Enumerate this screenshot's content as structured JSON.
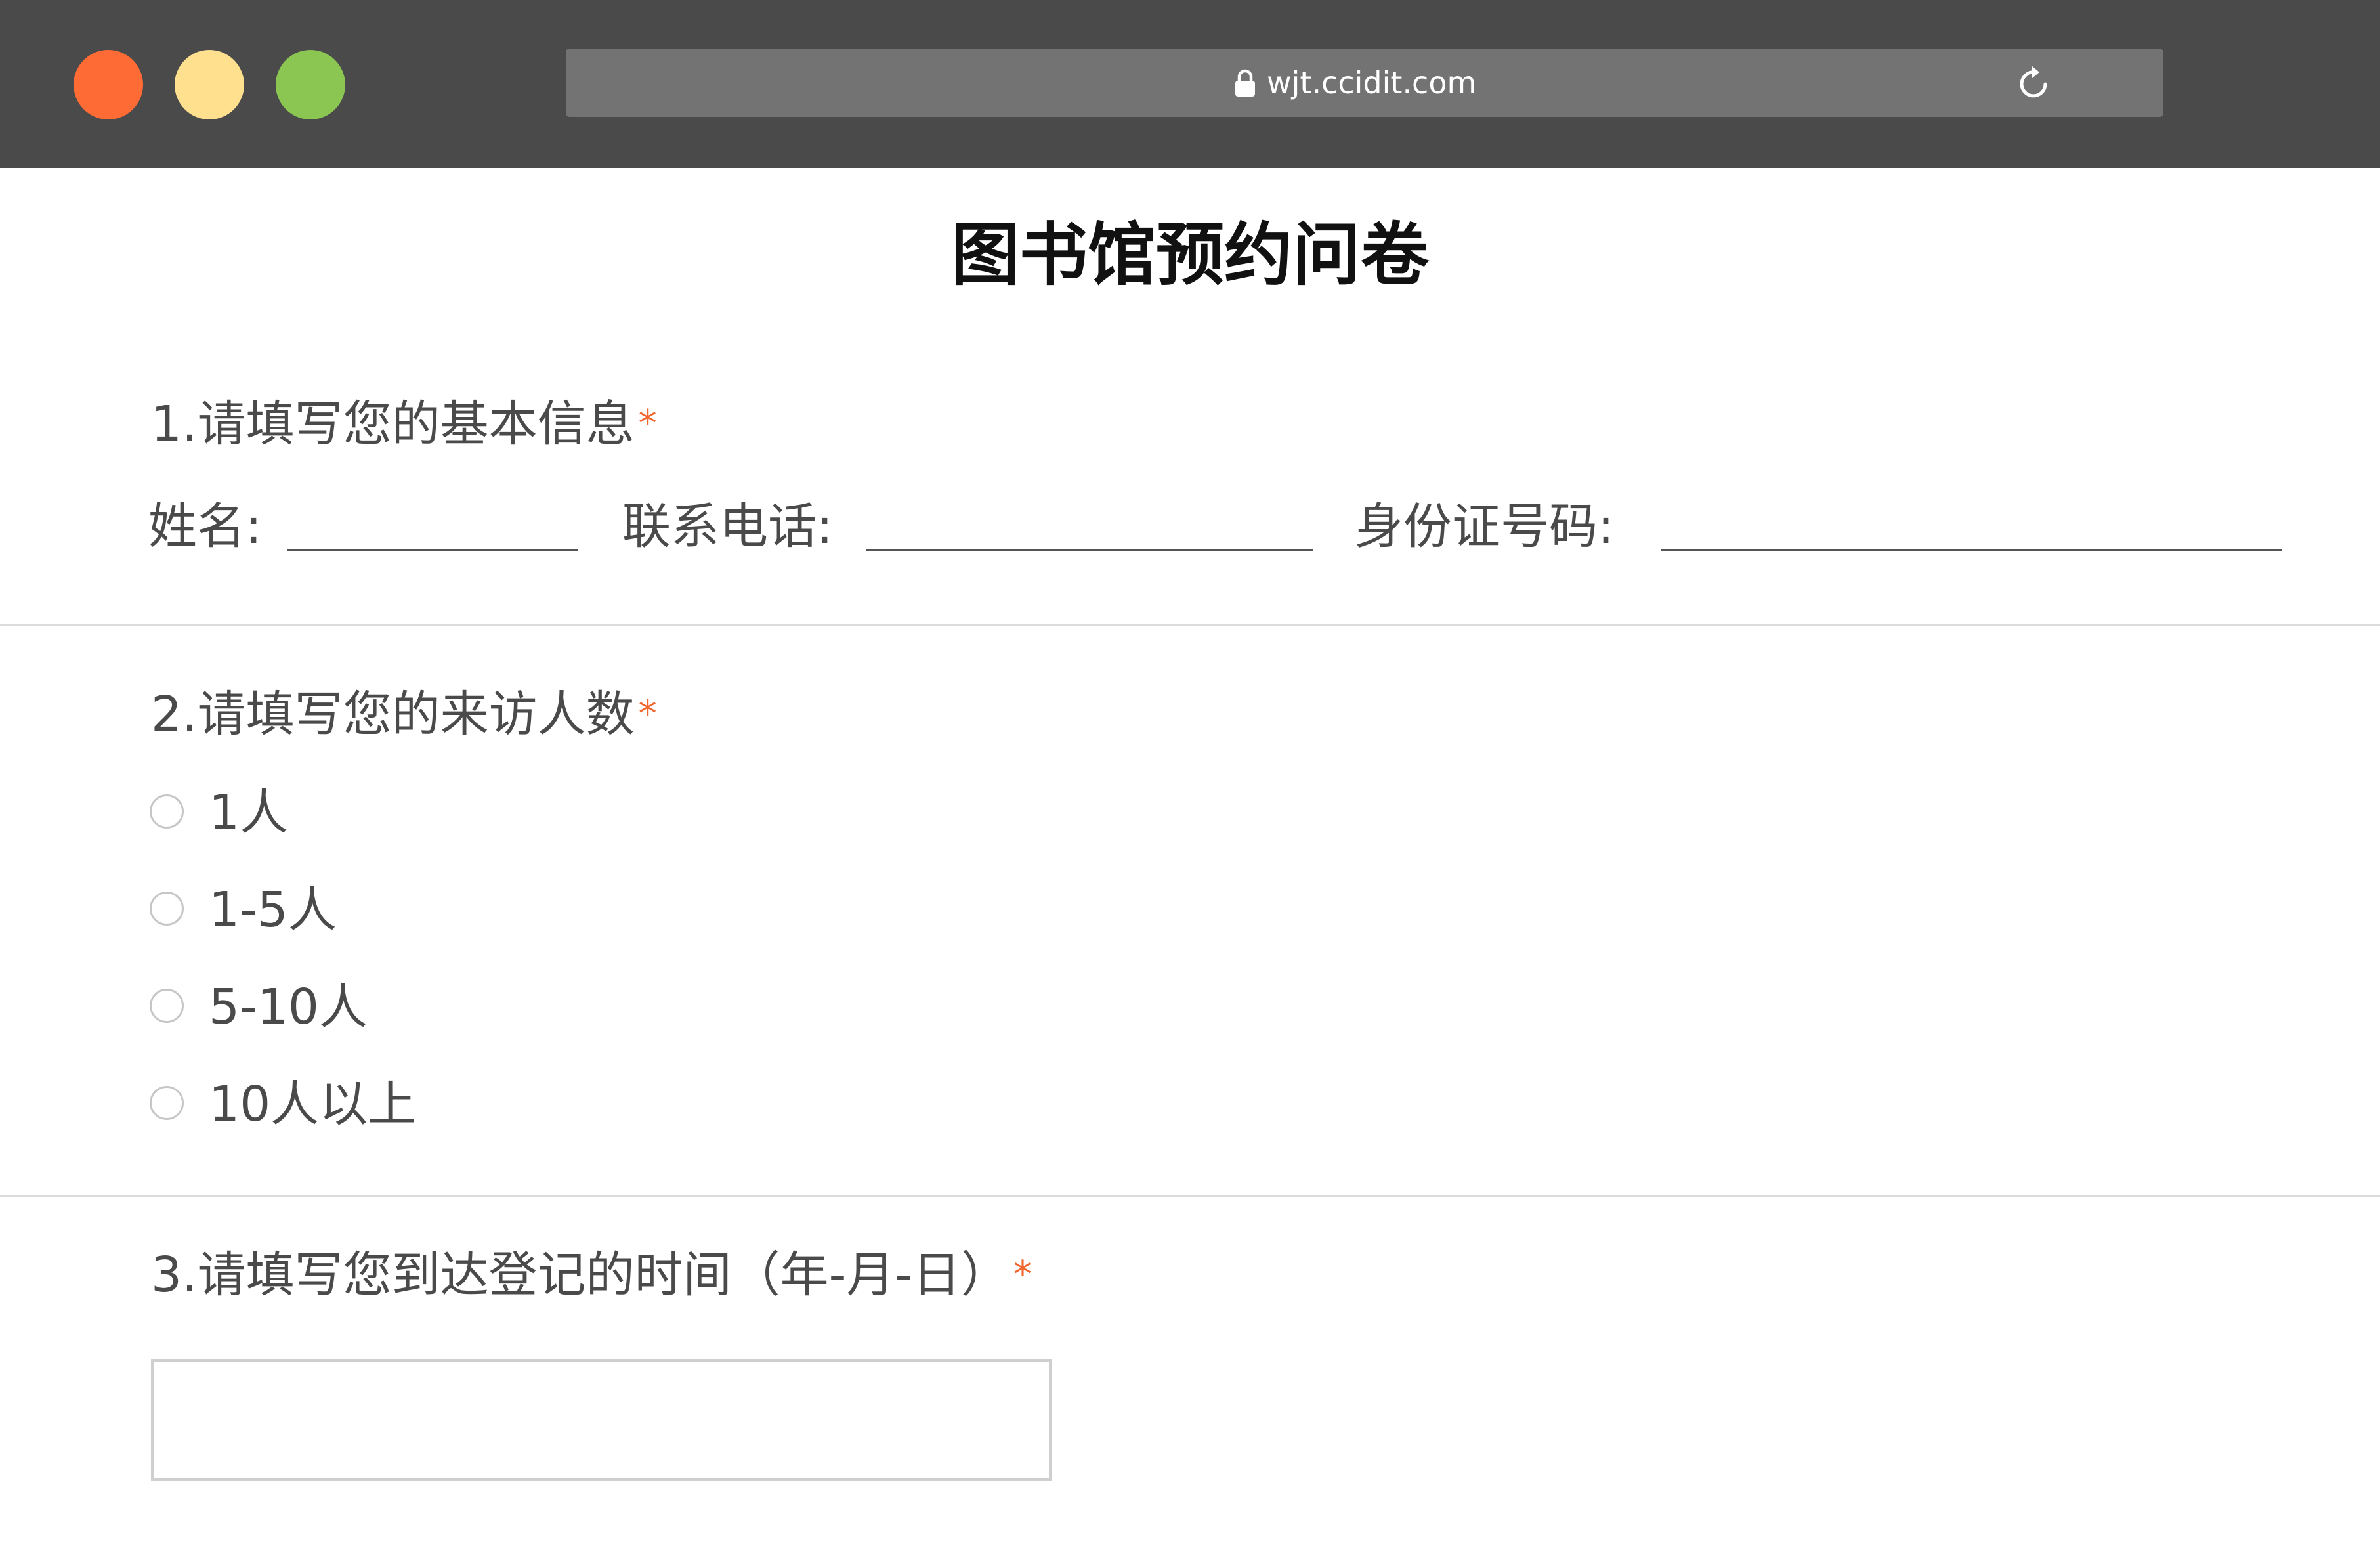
{
  "window": {
    "controls": [
      "close",
      "minimize",
      "maximize"
    ],
    "colors": {
      "close": "#ff6b35",
      "minimize": "#fee08e",
      "maximize": "#8bc653"
    }
  },
  "address_bar": {
    "url": "wjt.ccidit.com",
    "lock_icon": "lock-icon",
    "reload_icon": "reload-icon"
  },
  "page": {
    "title": "图书馆预约问卷"
  },
  "questions": {
    "q1": {
      "title": "1.请填写您的基本信息",
      "required_mark": "*",
      "fields": [
        {
          "label": "姓名:",
          "value": ""
        },
        {
          "label": "联系电话:",
          "value": ""
        },
        {
          "label": "身份证号码:",
          "value": ""
        }
      ]
    },
    "q2": {
      "title": "2.请填写您的来访人数",
      "required_mark": "*",
      "options": [
        "1人",
        "1-5人",
        "5-10人",
        "10人以上"
      ],
      "selected": null
    },
    "q3": {
      "title": "3.请填写您到达登记的时间（年-月-日）",
      "required_mark": "*",
      "value": ""
    }
  },
  "colors": {
    "required": "#f0662e",
    "chrome": "#4a4a4a",
    "url_bar": "#737373"
  }
}
